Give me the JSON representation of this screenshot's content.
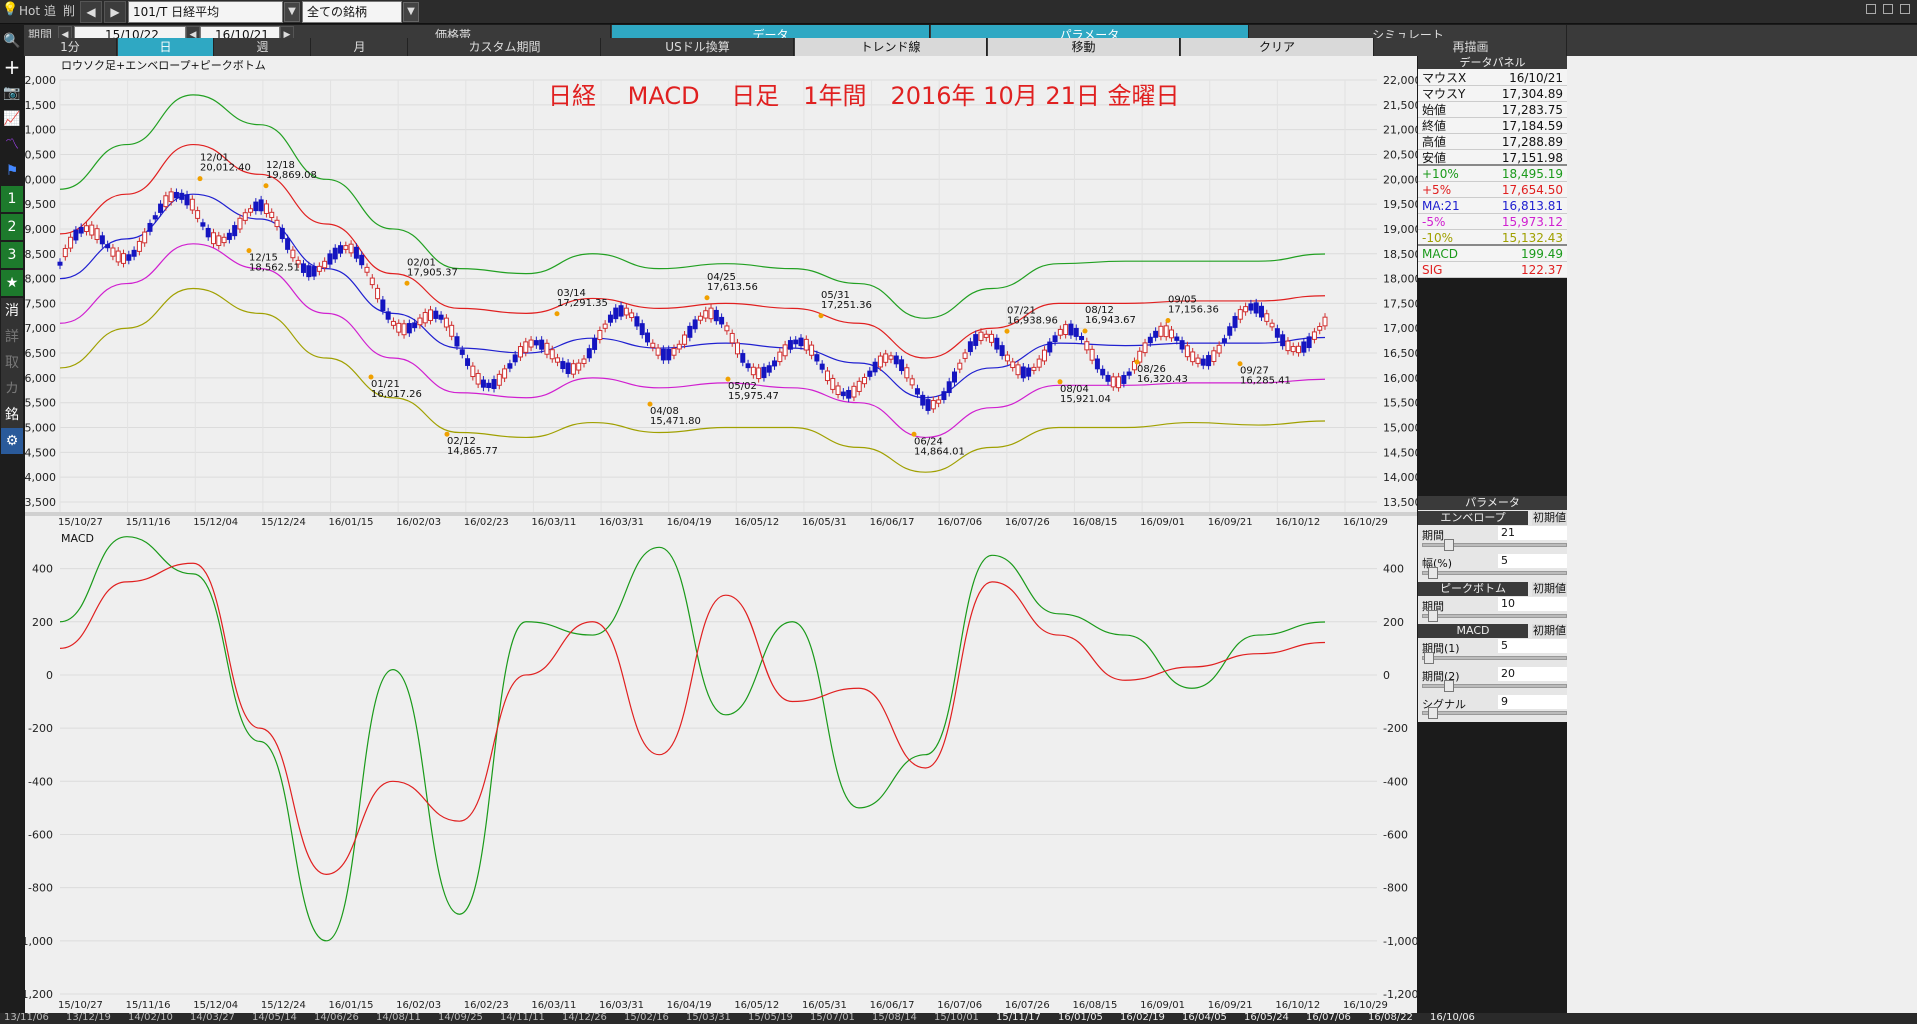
{
  "toolbar": {
    "hot": "Hot",
    "add": "追",
    "del": "削",
    "symbol": "101/T 日経平均",
    "universe": "全ての銘柄",
    "period_label": "期間",
    "date_from": "15/10/22",
    "tilde": "~",
    "date_to": "16/10/21"
  },
  "tabs_top": [
    "価格帯",
    "データ",
    "パラメータ",
    "シミュレート"
  ],
  "tabs_second": [
    "1分",
    "日",
    "週",
    "月",
    "カスタム期間",
    "USドル換算",
    "トレンド線",
    "移動",
    "クリア",
    "再描画"
  ],
  "left_tools": [
    "1",
    "2",
    "3",
    "★",
    "消",
    "詳",
    "取",
    "カ",
    "銘"
  ],
  "chart": {
    "indicator_label": "ロウソク足+エンベロープ+ピークボトム",
    "headline": "日経　 MACD　 日足　1年間　2016年 10月 21日 金曜日",
    "macd_label": "MACD",
    "price_ticks": [
      "22,000",
      "21,500",
      "21,000",
      "20,500",
      "20,000",
      "19,500",
      "19,000",
      "18,500",
      "18,000",
      "17,500",
      "17,000",
      "16,500",
      "16,000",
      "15,500",
      "15,000",
      "14,500",
      "14,000",
      "13,500"
    ],
    "macd_ticks": [
      "400",
      "200",
      "0",
      "-200",
      "-400",
      "-600",
      "-800",
      "-1,000",
      "-1,200"
    ],
    "date_ticks": [
      "15/10/27",
      "15/11/16",
      "15/12/04",
      "15/12/24",
      "16/01/15",
      "16/02/03",
      "16/02/23",
      "16/03/11",
      "16/03/31",
      "16/04/19",
      "16/05/12",
      "16/05/31",
      "16/06/17",
      "16/07/06",
      "16/07/26",
      "16/08/15",
      "16/09/01",
      "16/09/21",
      "16/10/12",
      "16/10/29"
    ],
    "peaks": [
      {
        "date": "12/01",
        "price": "20,012.40"
      },
      {
        "date": "12/18",
        "price": "19,869.08"
      },
      {
        "date": "12/15",
        "price": "18,562.51"
      },
      {
        "date": "01/21",
        "price": "16,017.26"
      },
      {
        "date": "02/01",
        "price": "17,905.37"
      },
      {
        "date": "02/12",
        "price": "14,865.77"
      },
      {
        "date": "03/14",
        "price": "17,291.35"
      },
      {
        "date": "04/08",
        "price": "15,471.80"
      },
      {
        "date": "04/25",
        "price": "17,613.56"
      },
      {
        "date": "05/02",
        "price": "15,975.47"
      },
      {
        "date": "05/31",
        "price": "17,251.36"
      },
      {
        "date": "06/24",
        "price": "14,864.01"
      },
      {
        "date": "07/21",
        "price": "16,938.96"
      },
      {
        "date": "08/04",
        "price": "15,921.04"
      },
      {
        "date": "08/12",
        "price": "16,943.67"
      },
      {
        "date": "08/26",
        "price": "16,320.43"
      },
      {
        "date": "09/05",
        "price": "17,156.36"
      },
      {
        "date": "09/27",
        "price": "16,285.41"
      }
    ]
  },
  "data_panel": {
    "title": "データパネル",
    "rows": [
      {
        "k": "マウスX",
        "v": "16/10/21",
        "color": "#111111"
      },
      {
        "k": "マウスY",
        "v": "17,304.89",
        "color": "#111111"
      },
      {
        "k": "始値",
        "v": "17,283.75",
        "color": "#111111"
      },
      {
        "k": "終値",
        "v": "17,184.59",
        "color": "#111111"
      },
      {
        "k": "高値",
        "v": "17,288.89",
        "color": "#111111"
      },
      {
        "k": "安値",
        "v": "17,151.98",
        "color": "#111111"
      },
      {
        "k": "+10%",
        "v": "18,495.19",
        "color": "#1a9a1a"
      },
      {
        "k": "+5%",
        "v": "17,654.50",
        "color": "#e02020"
      },
      {
        "k": "MA:21",
        "v": "16,813.81",
        "color": "#2020d0"
      },
      {
        "k": "-5%",
        "v": "15,973.12",
        "color": "#d020d0"
      },
      {
        "k": "-10%",
        "v": "15,132.43",
        "color": "#a0a000"
      },
      {
        "k": "MACD",
        "v": "199.49",
        "color": "#1a9a1a"
      },
      {
        "k": "SIG",
        "v": "122.37",
        "color": "#e02020"
      }
    ]
  },
  "param_panel": {
    "title": "パラメータ",
    "reset": "初期値",
    "envelope": {
      "title": "エンベロープ",
      "period_label": "期間",
      "period": "21",
      "width_label": "幅(%)",
      "width": "5"
    },
    "peak": {
      "title": "ピークボトム",
      "period_label": "期間",
      "period": "10"
    },
    "macd": {
      "title": "MACD",
      "p1_label": "期間(1)",
      "p1": "5",
      "p2_label": "期間(2)",
      "p2": "20",
      "sig_label": "シグナル",
      "sig": "9"
    }
  },
  "bottom_dates": [
    "13/11/06",
    "13/12/19",
    "14/02/10",
    "14/03/27",
    "14/05/14",
    "14/06/26",
    "14/08/11",
    "14/09/25",
    "14/11/11",
    "14/12/26",
    "15/02/16",
    "15/03/31",
    "15/05/19",
    "15/07/01",
    "15/08/14",
    "15/10/01",
    "15/11/17",
    "16/01/05",
    "16/02/19",
    "16/04/05",
    "16/05/24",
    "16/07/06",
    "16/08/22",
    "16/10/06"
  ],
  "colors": {
    "upper10": "#22a022",
    "upper5": "#e02020",
    "ma": "#2020d0",
    "lower5": "#d020d0",
    "lower10": "#a0a000",
    "headline": "#e02020",
    "macd": "#1a9a1a",
    "signal": "#e02020",
    "accent": "#2fa8c3"
  },
  "chart_data": [
    {
      "type": "line",
      "title": "日経　 MACD　 日足　1年間　2016年 10月 21日 金曜日",
      "x": [
        "15/10/27",
        "15/11/16",
        "15/12/04",
        "15/12/24",
        "16/01/15",
        "16/02/03",
        "16/02/23",
        "16/03/11",
        "16/03/31",
        "16/04/19",
        "16/05/12",
        "16/05/31",
        "16/06/17",
        "16/07/06",
        "16/07/26",
        "16/08/15",
        "16/09/01",
        "16/09/21",
        "16/10/12",
        "16/10/21"
      ],
      "ylim": [
        13500,
        22000
      ],
      "series": [
        {
          "name": "+10%",
          "values": [
            19800,
            20700,
            21700,
            21100,
            20000,
            19000,
            18200,
            18100,
            18500,
            18200,
            18300,
            18200,
            17900,
            17200,
            17800,
            18300,
            18350,
            18350,
            18350,
            18495
          ]
        },
        {
          "name": "+5%",
          "values": [
            18900,
            19700,
            20700,
            20100,
            19100,
            18100,
            17400,
            17300,
            17600,
            17400,
            17500,
            17400,
            17100,
            16400,
            17000,
            17500,
            17500,
            17550,
            17550,
            17654
          ]
        },
        {
          "name": "MA:21",
          "values": [
            18000,
            18800,
            19700,
            19200,
            18200,
            17300,
            16600,
            16500,
            16800,
            16600,
            16700,
            16600,
            16300,
            15600,
            16200,
            16700,
            16650,
            16700,
            16700,
            16813
          ]
        },
        {
          "name": "-5%",
          "values": [
            17100,
            17900,
            18700,
            18200,
            17300,
            16400,
            15700,
            15600,
            16000,
            15800,
            15900,
            15800,
            15500,
            14800,
            15400,
            15850,
            15850,
            15900,
            15900,
            15973
          ]
        },
        {
          "name": "-10%",
          "values": [
            16200,
            17000,
            17800,
            17300,
            16400,
            15600,
            14900,
            14800,
            15100,
            14900,
            15000,
            15000,
            14600,
            14100,
            14600,
            15000,
            15000,
            15100,
            15050,
            15132
          ]
        }
      ],
      "peaks": [
        {
          "x": "12/01",
          "y": 20012.4
        },
        {
          "x": "12/18",
          "y": 19869.08
        },
        {
          "x": "12/15",
          "y": 18562.51
        },
        {
          "x": "01/21",
          "y": 16017.26
        },
        {
          "x": "02/01",
          "y": 17905.37
        },
        {
          "x": "02/12",
          "y": 14865.77
        },
        {
          "x": "03/14",
          "y": 17291.35
        },
        {
          "x": "04/08",
          "y": 15471.8
        },
        {
          "x": "04/25",
          "y": 17613.56
        },
        {
          "x": "05/02",
          "y": 15975.47
        },
        {
          "x": "05/31",
          "y": 17251.36
        },
        {
          "x": "06/24",
          "y": 14864.01
        },
        {
          "x": "07/21",
          "y": 16938.96
        },
        {
          "x": "08/04",
          "y": 15921.04
        },
        {
          "x": "08/12",
          "y": 16943.67
        },
        {
          "x": "08/26",
          "y": 16320.43
        },
        {
          "x": "09/05",
          "y": 17156.36
        },
        {
          "x": "09/27",
          "y": 16285.41
        }
      ]
    },
    {
      "type": "line",
      "title": "MACD",
      "x": [
        "15/10/27",
        "15/11/16",
        "15/12/04",
        "15/12/24",
        "16/01/15",
        "16/02/03",
        "16/02/23",
        "16/03/11",
        "16/03/31",
        "16/04/19",
        "16/05/12",
        "16/05/31",
        "16/06/17",
        "16/07/06",
        "16/07/26",
        "16/08/15",
        "16/09/01",
        "16/09/21",
        "16/10/12",
        "16/10/21"
      ],
      "ylim": [
        -1200,
        500
      ],
      "series": [
        {
          "name": "MACD",
          "values": [
            200,
            520,
            380,
            -250,
            -1000,
            20,
            -900,
            200,
            150,
            480,
            -150,
            200,
            -500,
            -300,
            450,
            230,
            150,
            -50,
            150,
            199
          ]
        },
        {
          "name": "SIG",
          "values": [
            100,
            350,
            420,
            -200,
            -750,
            -400,
            -550,
            0,
            200,
            -300,
            300,
            -100,
            -50,
            -350,
            350,
            150,
            -20,
            30,
            80,
            122
          ]
        }
      ]
    }
  ]
}
